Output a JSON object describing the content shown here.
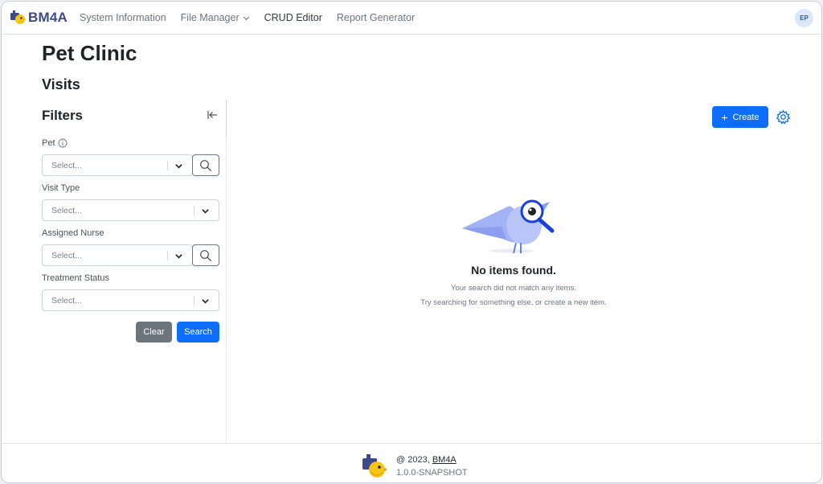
{
  "navbar": {
    "brand": "BM4A",
    "brand_icon": "bm4a-logo-icon",
    "items": [
      {
        "label": "System Information"
      },
      {
        "label": "File Manager",
        "has_dropdown": true
      },
      {
        "label": "CRUD Editor",
        "active": true
      },
      {
        "label": "Report Generator"
      }
    ],
    "user_initials": "EP"
  },
  "app_title": "Pet Clinic",
  "page_title": "Visits",
  "filters": {
    "title": "Filters",
    "fields": [
      {
        "label": "Pet",
        "placeholder": "Select...",
        "has_info": true,
        "has_lookup": true
      },
      {
        "label": "Visit Type",
        "placeholder": "Select...",
        "has_info": false,
        "has_lookup": false
      },
      {
        "label": "Assigned Nurse",
        "placeholder": "Select...",
        "has_info": false,
        "has_lookup": true
      },
      {
        "label": "Treatment Status",
        "placeholder": "Select...",
        "has_info": false,
        "has_lookup": false
      }
    ],
    "clear_label": "Clear",
    "search_label": "Search"
  },
  "toolbar": {
    "create_label": "Create",
    "create_icon": "plus-icon",
    "settings_icon": "gear-icon"
  },
  "empty_state": {
    "title": "No items found.",
    "line1": "Your search did not match any items.",
    "line2": "Try searching for something else, or create a new item."
  },
  "footer": {
    "copyright_prefix": "@ 2023,",
    "copyright_link": "BM4A",
    "version": "1.0.0-SNAPSHOT"
  },
  "colors": {
    "primary": "#0d6efd",
    "secondary": "#6c757d",
    "brand": "#3d4a8a",
    "bird": "#a3b2f5",
    "avatar_bg": "#dbe8fb"
  }
}
